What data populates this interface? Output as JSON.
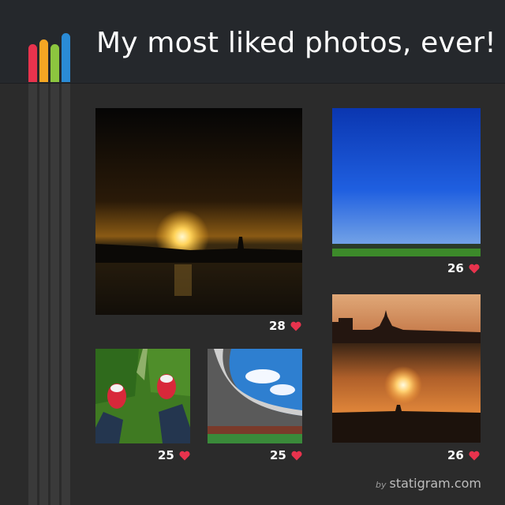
{
  "header": {
    "title": "My most liked photos, ever!",
    "logo_colors": [
      "#e8334d",
      "#f5a623",
      "#8cc63f",
      "#2a8bd6"
    ]
  },
  "photos": [
    {
      "id": "sunset-lake",
      "description_icon": "sunset-lake-photo",
      "likes": "28"
    },
    {
      "id": "blue-sky-field",
      "description_icon": "blue-sky-photo",
      "likes": "26"
    },
    {
      "id": "red-sneakers",
      "description_icon": "sneakers-photo",
      "likes": "25"
    },
    {
      "id": "stadium",
      "description_icon": "stadium-photo",
      "likes": "25"
    },
    {
      "id": "orange-sunset-city",
      "description_icon": "city-sunset-photo",
      "likes": "26"
    }
  ],
  "heart_color": "#e8334d",
  "footer": {
    "by": "by",
    "brand": "statigram.com"
  }
}
